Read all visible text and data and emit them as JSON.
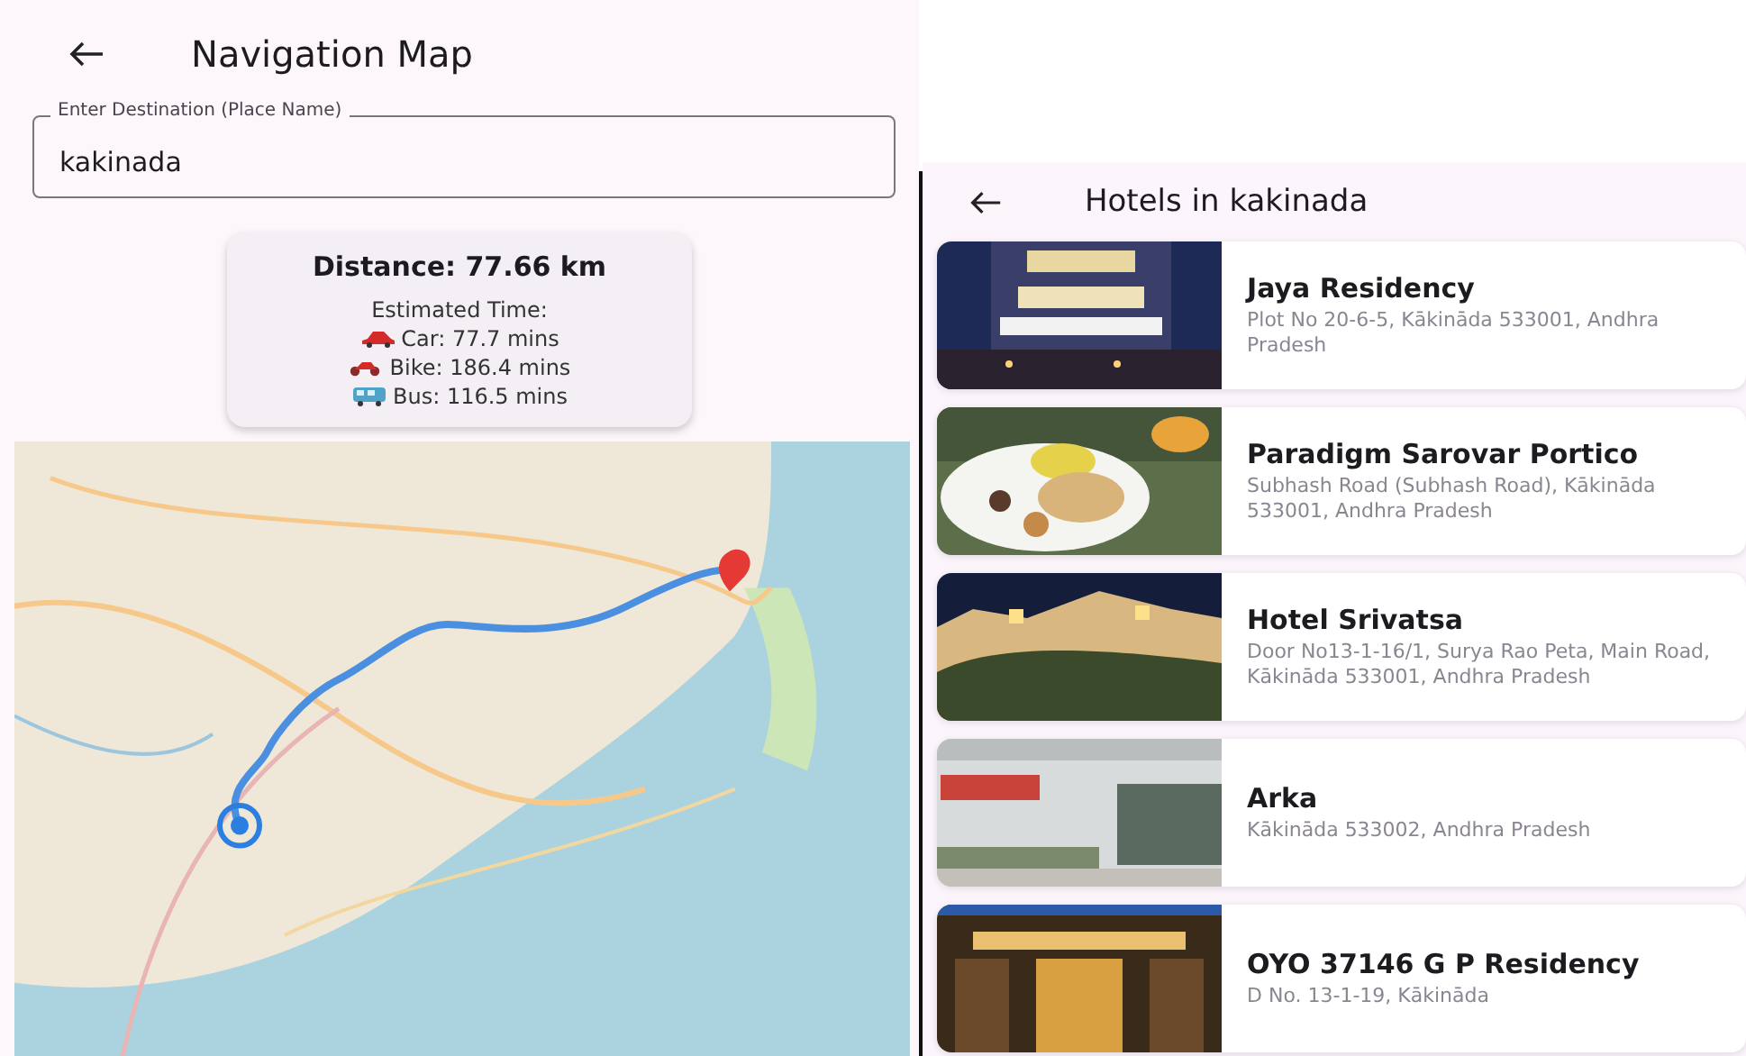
{
  "left_screen": {
    "title": "Navigation Map",
    "destination_field": {
      "label": "Enter Destination (Place Name)",
      "value": "kakinada"
    },
    "summary_card": {
      "distance": "Distance: 77.66 km",
      "estimated_label": "Estimated Time:",
      "modes": [
        {
          "kind": "car",
          "text": "Car: 77.7 mins"
        },
        {
          "kind": "bike",
          "text": "Bike: 186.4 mins"
        },
        {
          "kind": "bus",
          "text": "Bus: 116.5 mins"
        }
      ]
    }
  },
  "right_screen": {
    "title": "Hotels in kakinada",
    "hotels": [
      {
        "name": "Jaya Residency",
        "address": "Plot No 20-6-5, Kākināda 533001, Andhra Pradesh"
      },
      {
        "name": "Paradigm Sarovar Portico",
        "address": "Subhash Road (Subhash Road), Kākināda 533001, Andhra Pradesh"
      },
      {
        "name": "Hotel Srivatsa",
        "address": "Door No13-1-16/1, Surya Rao Peta, Main Road, Kākināda 533001, Andhra Pradesh"
      },
      {
        "name": "Arka",
        "address": "Kākināda 533002, Andhra Pradesh"
      },
      {
        "name": "OYO 37146 G P Residency",
        "address": "D No. 13-1-19, Kākināda"
      }
    ]
  }
}
